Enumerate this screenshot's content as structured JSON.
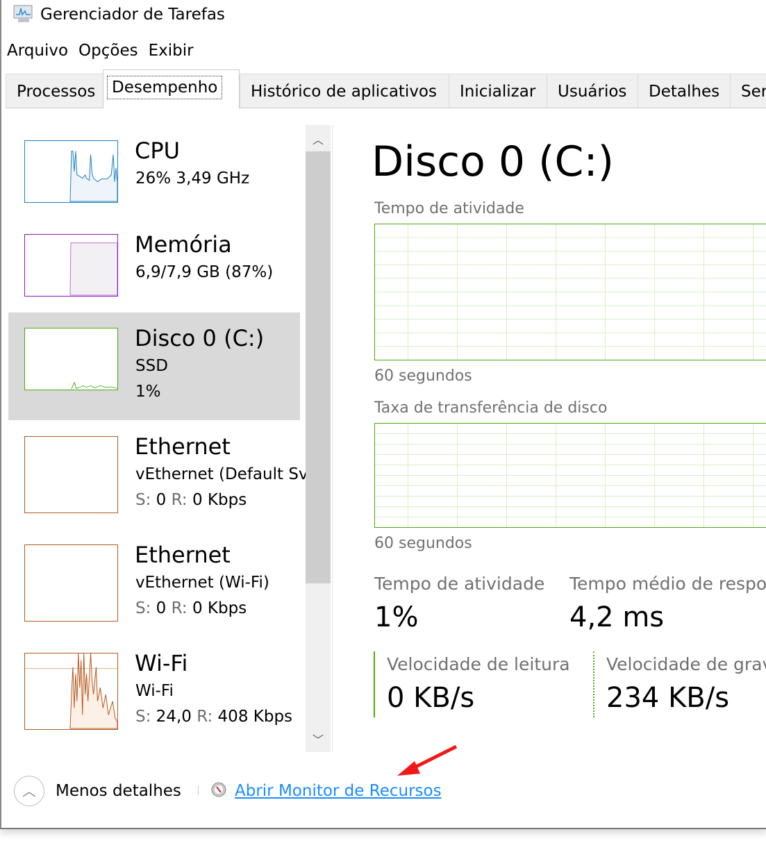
{
  "window": {
    "title": "Gerenciador de Tarefas",
    "icon": "task-manager-icon"
  },
  "menu": [
    {
      "label": "Arquivo"
    },
    {
      "label": "Opções"
    },
    {
      "label": "Exibir"
    }
  ],
  "tabs": [
    {
      "label": "Processos"
    },
    {
      "label": "Desempenho",
      "active": true
    },
    {
      "label": "Histórico de aplicativos"
    },
    {
      "label": "Inicializar"
    },
    {
      "label": "Usuários"
    },
    {
      "label": "Detalhes"
    },
    {
      "label": "Ser"
    }
  ],
  "sidebar": {
    "items": [
      {
        "name": "CPU",
        "line1": "26%  3,49 GHz",
        "color": "#1a7fc2"
      },
      {
        "name": "Memória",
        "line1": "6,9/7,9 GB (87%)",
        "color": "#8b18b8"
      },
      {
        "name": "Disco 0 (C:)",
        "line1": "SSD",
        "line2": "1%",
        "color": "#4aa80c",
        "selected": true
      },
      {
        "name": "Ethernet",
        "line1": "vEthernet (Default Sv",
        "s_label": "S:",
        "s_value": "0",
        "r_label": "R:",
        "r_value": "0 Kbps",
        "color": "#b4571e"
      },
      {
        "name": "Ethernet",
        "line1": "vEthernet (Wi-Fi)",
        "s_label": "S:",
        "s_value": "0",
        "r_label": "R:",
        "r_value": "0 Kbps",
        "color": "#b4571e"
      },
      {
        "name": "Wi-Fi",
        "line1": "Wi-Fi",
        "s_label": "S:",
        "s_value": "24,0",
        "r_label": "R:",
        "r_value": "408 Kbps",
        "color": "#b4571e"
      }
    ]
  },
  "detail": {
    "title": "Disco 0 (C:)",
    "chart1_label": "Tempo de atividade",
    "chart1_time": "60 segundos",
    "chart2_label": "Taxa de transferência de disco",
    "chart2_time": "60 segundos",
    "stats": [
      {
        "label": "Tempo de atividade",
        "value": "1%"
      },
      {
        "label": "Tempo médio de respos",
        "value": "4,2 ms"
      },
      {
        "label": "Velocidade de leitura",
        "value": "0 KB/s"
      },
      {
        "label": "Velocidade de grava",
        "value": "234 KB/s"
      }
    ]
  },
  "footer": {
    "less_details": "Menos detalhes",
    "open_monitor": "Abrir Monitor de Recursos",
    "link_color": "#1a8cff"
  }
}
